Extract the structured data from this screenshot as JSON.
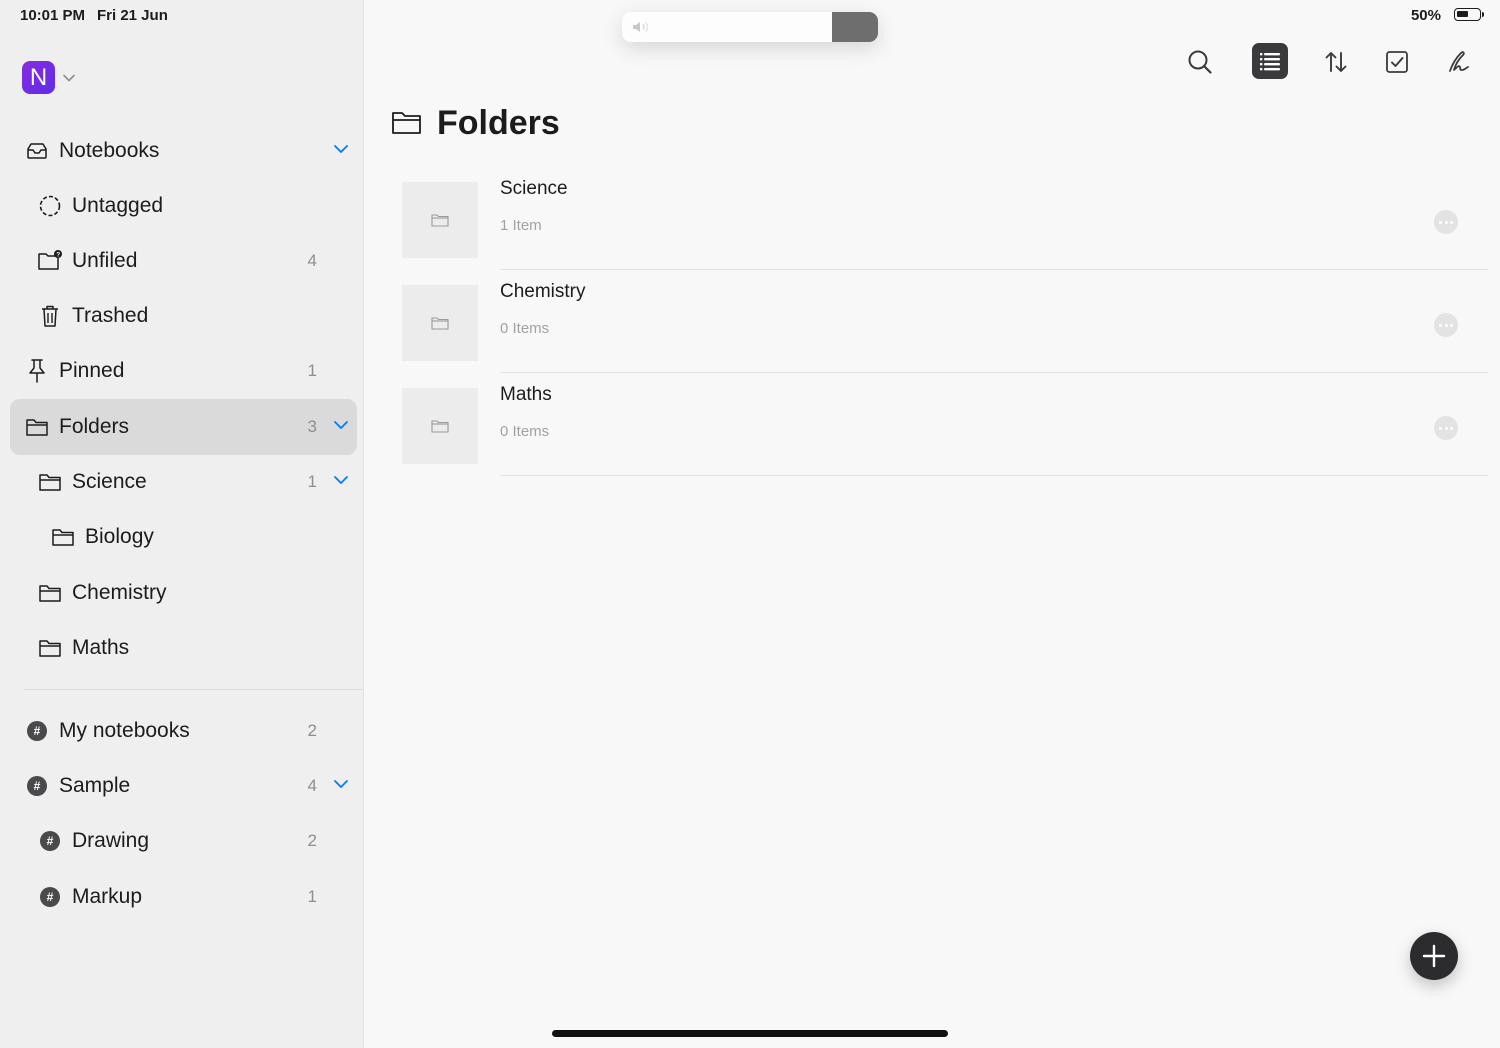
{
  "status_bar": {
    "time": "10:01 PM",
    "date": "Fri 21 Jun",
    "battery": "50%"
  },
  "account": {
    "initial": "N"
  },
  "sidebar": {
    "notebooks": {
      "label": "Notebooks"
    },
    "untagged": {
      "label": "Untagged"
    },
    "unfiled": {
      "label": "Unfiled",
      "count": "4"
    },
    "trashed": {
      "label": "Trashed"
    },
    "pinned": {
      "label": "Pinned",
      "count": "1"
    },
    "folders": {
      "label": "Folders",
      "count": "3",
      "selected": true
    },
    "science": {
      "label": "Science",
      "count": "1"
    },
    "biology": {
      "label": "Biology"
    },
    "chemistry": {
      "label": "Chemistry"
    },
    "maths": {
      "label": "Maths"
    },
    "my_notebooks": {
      "label": "My notebooks",
      "count": "2"
    },
    "sample": {
      "label": "Sample",
      "count": "4"
    },
    "drawing": {
      "label": "Drawing",
      "count": "2"
    },
    "markup": {
      "label": "Markup",
      "count": "1"
    }
  },
  "main": {
    "title": "Folders",
    "folders": [
      {
        "name": "Science",
        "count": "1 Item"
      },
      {
        "name": "Chemistry",
        "count": "0 Items"
      },
      {
        "name": "Maths",
        "count": "0 Items"
      }
    ]
  },
  "toolbar": {
    "icons": [
      "search-icon",
      "list-view-icon",
      "sort-icon",
      "checkbox-icon",
      "handwriting-icon"
    ]
  },
  "volume_hud": {
    "level": 0.18
  },
  "colors": {
    "accent": "#007aff",
    "avatar_start": "#8a2be2",
    "avatar_end": "#5b2ee6",
    "selected_row": "#dadada",
    "fab": "#2c2c2e"
  }
}
